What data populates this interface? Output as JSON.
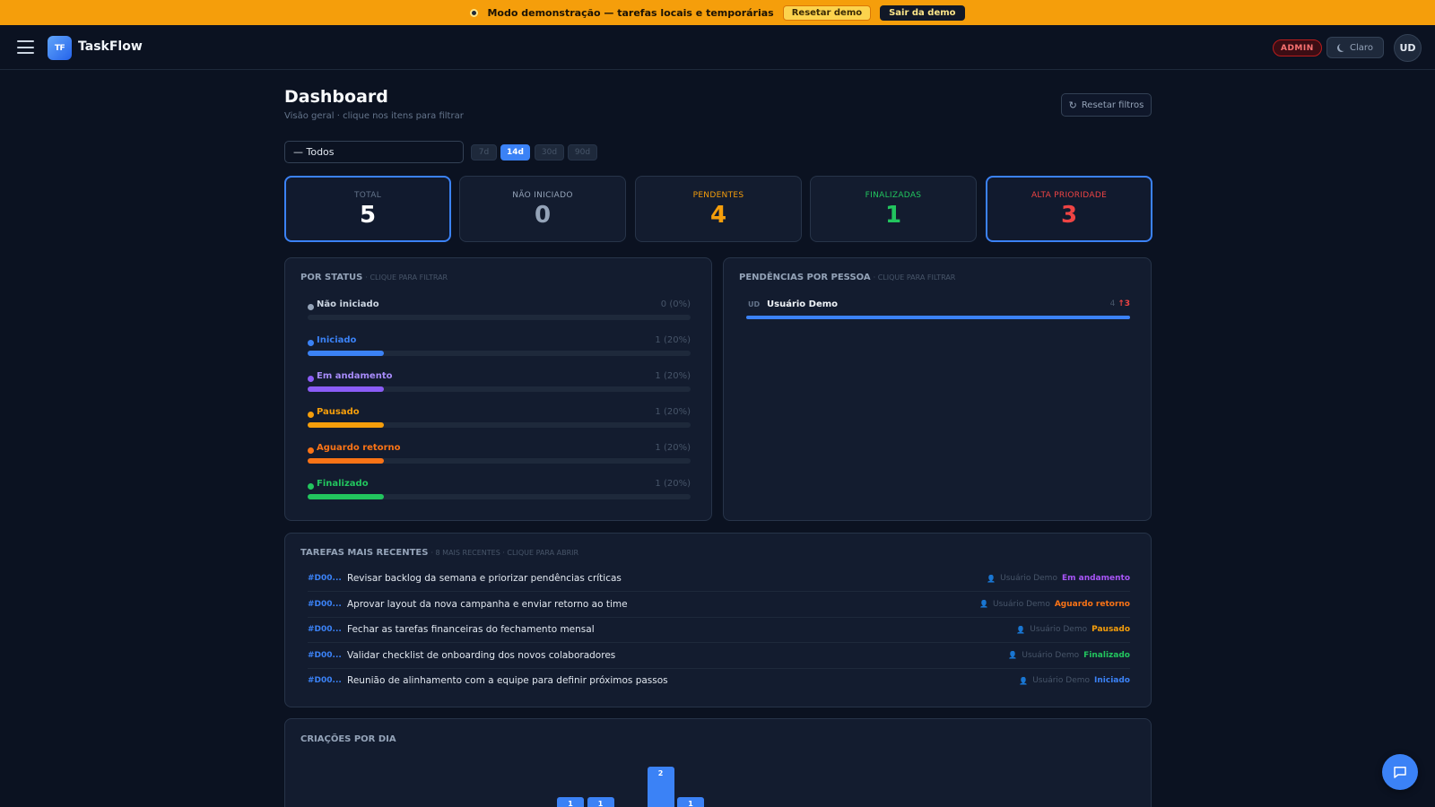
{
  "demo_bar": {
    "message": "Modo demonstração — tarefas locais e temporárias",
    "reset_label": "Resetar demo",
    "exit_label": "Sair da demo"
  },
  "header": {
    "logo_mark": "TF",
    "app_name": "TaskFlow",
    "role_badge": "ADMIN",
    "theme_label": "Claro",
    "avatar_initials": "UD"
  },
  "page": {
    "title": "Dashboard",
    "subtitle": "Visão geral · clique nos itens para filtrar",
    "reset_filters_label": "Resetar filtros"
  },
  "filters": {
    "person_select": "— Todos",
    "periods": [
      {
        "label": "7d",
        "active": false
      },
      {
        "label": "14d",
        "active": true
      },
      {
        "label": "30d",
        "active": false
      },
      {
        "label": "90d",
        "active": false
      }
    ]
  },
  "kpis": [
    {
      "label": "TOTAL",
      "value": "5",
      "label_color": "#64748b",
      "value_color": "#ffffff",
      "selected": true
    },
    {
      "label": "NÃO INICIADO",
      "value": "0",
      "label_color": "#94a3b8",
      "value_color": "#94a3b8",
      "selected": false
    },
    {
      "label": "PENDENTES",
      "value": "4",
      "label_color": "#f59e0b",
      "value_color": "#f59e0b",
      "selected": false
    },
    {
      "label": "FINALIZADAS",
      "value": "1",
      "label_color": "#22c55e",
      "value_color": "#22c55e",
      "selected": false
    },
    {
      "label": "ALTA PRIORIDADE",
      "value": "3",
      "label_color": "#ef4444",
      "value_color": "#ef4444",
      "selected": true
    }
  ],
  "status_panel": {
    "title": "POR STATUS",
    "hint": "· CLIQUE PARA FILTRAR",
    "items": [
      {
        "name": "Não iniciado",
        "count": "0 (0%)",
        "fraction": 0,
        "color": "#94a3b8",
        "text_color": "#cbd5e1"
      },
      {
        "name": "Iniciado",
        "count": "1 (20%)",
        "fraction": 0.2,
        "color": "#3b82f6",
        "text_color": "#3b82f6"
      },
      {
        "name": "Em andamento",
        "count": "1 (20%)",
        "fraction": 0.2,
        "color": "#8b5cf6",
        "text_color": "#a78bfa"
      },
      {
        "name": "Pausado",
        "count": "1 (20%)",
        "fraction": 0.2,
        "color": "#f59e0b",
        "text_color": "#f59e0b"
      },
      {
        "name": "Aguardo retorno",
        "count": "1 (20%)",
        "fraction": 0.2,
        "color": "#f97316",
        "text_color": "#f97316"
      },
      {
        "name": "Finalizado",
        "count": "1 (20%)",
        "fraction": 0.2,
        "color": "#22c55e",
        "text_color": "#22c55e"
      }
    ]
  },
  "people_panel": {
    "title": "PENDÊNCIAS POR PESSOA",
    "hint": "· CLIQUE PARA FILTRAR",
    "items": [
      {
        "initials": "UD",
        "name": "Usuário Demo",
        "pending": "4",
        "high": "↑3"
      }
    ]
  },
  "recent_panel": {
    "title": "TAREFAS MAIS RECENTES",
    "hint": "· 8 MAIS RECENTES · CLIQUE PARA ABRIR",
    "tasks": [
      {
        "id": "#D00...",
        "title": "Revisar backlog da semana e priorizar pendências críticas",
        "person": "Usuário Demo",
        "status": "Em andamento",
        "status_color": "#a855f7"
      },
      {
        "id": "#D00...",
        "title": "Aprovar layout da nova campanha e enviar retorno ao time",
        "person": "Usuário Demo",
        "status": "Aguardo retorno",
        "status_color": "#f97316"
      },
      {
        "id": "#D00...",
        "title": "Fechar as tarefas financeiras do fechamento mensal",
        "person": "Usuário Demo",
        "status": "Pausado",
        "status_color": "#f59e0b"
      },
      {
        "id": "#D00...",
        "title": "Validar checklist de onboarding dos novos colaboradores",
        "person": "Usuário Demo",
        "status": "Finalizado",
        "status_color": "#22c55e"
      },
      {
        "id": "#D00...",
        "title": "Reunião de alinhamento com a equipe para definir próximos passos",
        "person": "Usuário Demo",
        "status": "Iniciado",
        "status_color": "#3b82f6"
      }
    ]
  },
  "daily_panel": {
    "title": "CRIAÇÕES POR DIA",
    "chart_max": 2,
    "bars": [
      {
        "value": 1,
        "label": "1",
        "slot": 0
      },
      {
        "value": 1,
        "label": "1",
        "slot": 1
      },
      {
        "value": 2,
        "label": "2",
        "slot": 3
      },
      {
        "value": 1,
        "label": "1",
        "slot": 4
      }
    ]
  },
  "colors": {
    "accent": "#3b82f6",
    "demo_banner": "#f59e0b",
    "background": "#0b1221",
    "card": "#131c2f"
  },
  "icons": {
    "menu": "hamburger-menu-icon",
    "theme": "moon-icon",
    "reset": "refresh-icon",
    "person": "person-icon",
    "chat": "chat-bubble-icon"
  }
}
